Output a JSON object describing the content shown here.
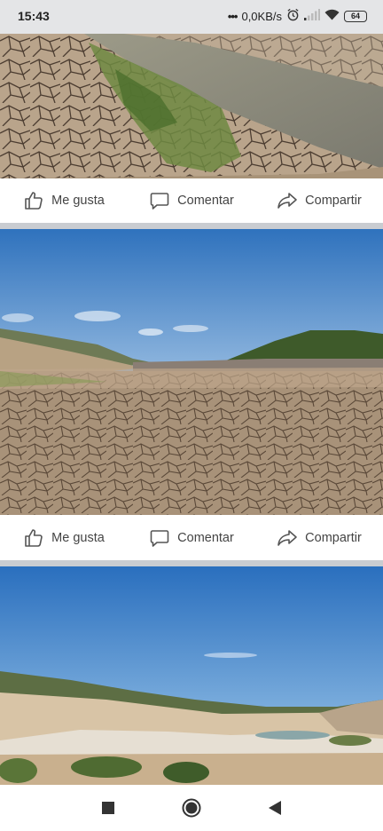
{
  "status_bar": {
    "time": "15:43",
    "network_speed": "0,0KB/s",
    "battery_level": "64",
    "icons": [
      "alarm-icon",
      "signal-icon",
      "wifi-icon",
      "battery-icon"
    ]
  },
  "posts": [
    {
      "photo_subject": "cracked dry earth beside a canal",
      "actions": {
        "like": "Me gusta",
        "comment": "Comentar",
        "share": "Compartir"
      }
    },
    {
      "photo_subject": "dried reservoir bed with hills",
      "actions": {
        "like": "Me gusta",
        "comment": "Comentar",
        "share": "Compartir"
      }
    },
    {
      "photo_subject": "low reservoir valley"
    }
  ],
  "nav_bar": {
    "icons": [
      "recent-apps-icon",
      "home-icon",
      "back-icon"
    ]
  },
  "colors": {
    "status_bar_bg": "#e4e5e7",
    "divider": "#c9ccd1",
    "action_text": "#444444"
  }
}
